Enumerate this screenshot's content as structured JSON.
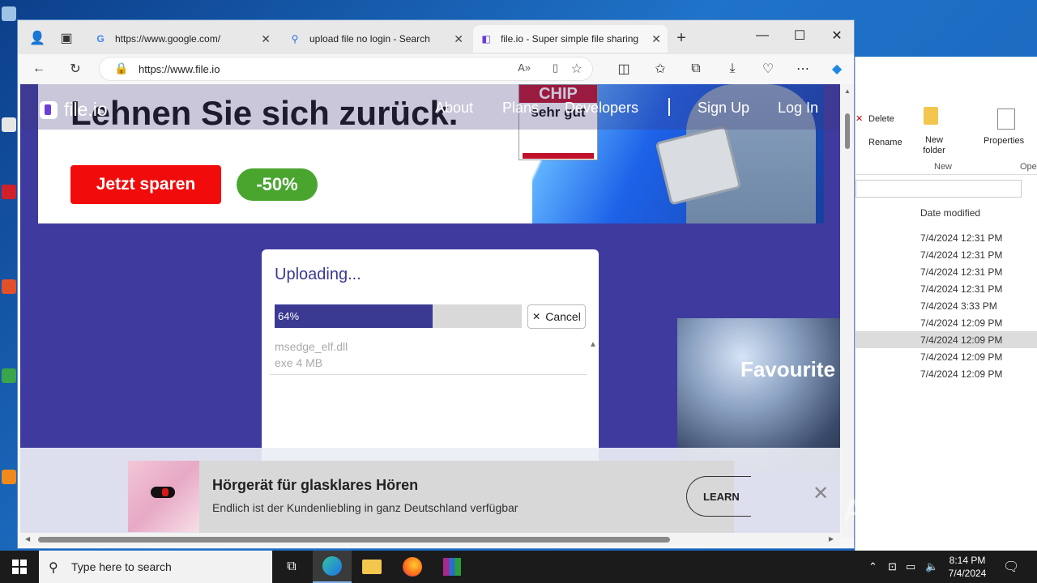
{
  "browser": {
    "tabs": [
      {
        "title": "https://www.google.com/",
        "active": false
      },
      {
        "title": "upload file no login - Search",
        "active": false
      },
      {
        "title": "file.io - Super simple file sharing",
        "active": true
      }
    ],
    "url": "https://www.file.io"
  },
  "ad_top": {
    "headline": "Lehnen Sie sich zurück.",
    "cta": "Jetzt sparen",
    "discount": "-50%",
    "badge_top": "CHIP",
    "badge_main": "sehr gut"
  },
  "site": {
    "logo": "file.io",
    "nav": [
      "About",
      "Plans",
      "Developers",
      "Sign Up",
      "Log In"
    ]
  },
  "upload": {
    "title": "Uploading...",
    "progress_label": "64%",
    "progress": 0.64,
    "cancel": "Cancel",
    "file_name": "msedge_elf.dll",
    "file_meta": "exe 4 MB"
  },
  "ad_side": {
    "text": "Favourite"
  },
  "ad_bottom": {
    "headline": "Hörgerät für glasklares Hören",
    "subline": "Endlich ist der Kundenliebling in ganz Deutschland verfügbar",
    "cta": "LEARN"
  },
  "explorer": {
    "delete": "Delete",
    "rename": "Rename",
    "new_folder": "New folder",
    "new_group": "New",
    "properties": "Properties",
    "open_group": "Ope",
    "column": "Date modified",
    "dates": [
      "7/4/2024 12:31 PM",
      "7/4/2024 12:31 PM",
      "7/4/2024 12:31 PM",
      "7/4/2024 12:31 PM",
      "7/4/2024 3:33 PM",
      "7/4/2024 12:09 PM",
      "7/4/2024 12:09 PM",
      "7/4/2024 12:09 PM",
      "7/4/2024 12:09 PM"
    ]
  },
  "taskbar": {
    "search_placeholder": "Type here to search",
    "time": "8:14 PM",
    "date": "7/4/2024"
  },
  "watermark": "ANY RUN",
  "colors": {
    "site_bg": "#3f3b9e",
    "progress": "#3b3a93",
    "accent_red": "#f10b0b",
    "accent_green": "#4aa52f"
  }
}
